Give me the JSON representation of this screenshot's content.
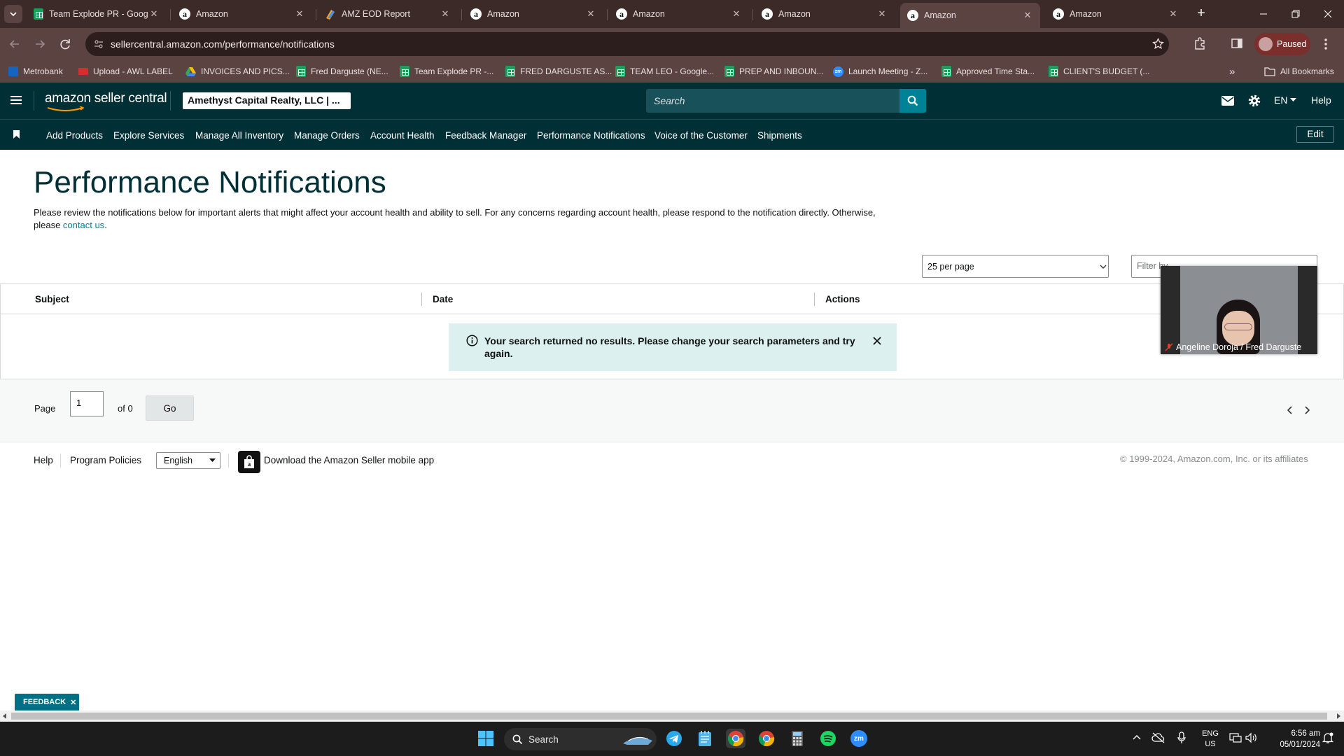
{
  "browser": {
    "tabs": [
      {
        "title": "Team Explode PR - Google Sheets",
        "icon": "sheets-icon",
        "active": false
      },
      {
        "title": "Amazon",
        "icon": "amazon-icon",
        "active": false
      },
      {
        "title": "AMZ EOD Report",
        "icon": "report-icon",
        "active": false
      },
      {
        "title": "Amazon",
        "icon": "amazon-icon",
        "active": false
      },
      {
        "title": "Amazon",
        "icon": "amazon-icon",
        "active": false
      },
      {
        "title": "Amazon",
        "icon": "amazon-icon",
        "active": false
      },
      {
        "title": "Amazon",
        "icon": "amazon-icon",
        "active": true
      },
      {
        "title": "Amazon",
        "icon": "amazon-icon",
        "active": false
      }
    ],
    "url": "sellercentral.amazon.com/performance/notifications",
    "profile_label": "Paused",
    "bookmarks": [
      {
        "label": "Metrobank",
        "icon": "metrobank-icon"
      },
      {
        "label": "Upload - AWL LABEL",
        "icon": "awl-icon"
      },
      {
        "label": "INVOICES AND PICS...",
        "icon": "drive-icon"
      },
      {
        "label": "Fred Darguste (NE...",
        "icon": "sheets-icon"
      },
      {
        "label": "Team Explode PR -...",
        "icon": "sheets-icon"
      },
      {
        "label": "FRED DARGUSTE AS...",
        "icon": "sheets-icon"
      },
      {
        "label": "TEAM LEO - Google...",
        "icon": "sheets-icon"
      },
      {
        "label": "PREP AND INBOUN...",
        "icon": "sheets-icon"
      },
      {
        "label": "Launch Meeting - Z...",
        "icon": "zoom-icon"
      },
      {
        "label": "Approved Time Sta...",
        "icon": "sheets-icon"
      },
      {
        "label": "CLIENT'S BUDGET (...",
        "icon": "sheets-icon"
      }
    ],
    "all_bookmarks_label": "All Bookmarks"
  },
  "seller_central": {
    "logo_text": "amazon seller central",
    "account_selector": "Amethyst Capital Realty, LLC | ...",
    "search_placeholder": "Search",
    "language": "EN",
    "help_label": "Help",
    "nav_items": [
      "Add Products",
      "Explore Services",
      "Manage All Inventory",
      "Manage Orders",
      "Account Health",
      "Feedback Manager",
      "Performance Notifications",
      "Voice of the Customer",
      "Shipments"
    ],
    "edit_label": "Edit"
  },
  "page": {
    "title": "Performance Notifications",
    "description_main": "Please review the notifications below for important alerts that might affect your account health and ability to sell. For any concerns regarding account health, please respond to the notification directly. Otherwise, please ",
    "contact_link": "contact us",
    "description_end": ".",
    "per_page": "25 per page",
    "filter_placeholder": "Filter by",
    "columns": [
      "Subject",
      "Date",
      "Actions"
    ],
    "alert_message": "Your search returned no results. Please change your search parameters and try again.",
    "pager": {
      "page_label": "Page",
      "page_value": "1",
      "of_label": "of 0",
      "go_label": "Go"
    }
  },
  "footer": {
    "help": "Help",
    "program_policies": "Program Policies",
    "language": "English",
    "download_app": "Download the Amazon Seller mobile app",
    "copyright": "© 1999-2024, Amazon.com, Inc. or its affiliates"
  },
  "video_overlay": {
    "name": "Angeline Doroja / Fred Darguste"
  },
  "feedback_label": "FEEDBACK",
  "taskbar": {
    "search_label": "Search",
    "lang_top": "ENG",
    "lang_bottom": "US",
    "time": "6:56 am",
    "date": "05/01/2024"
  },
  "colors": {
    "sc_header": "#002f36",
    "sc_teal": "#008296",
    "alert_bg": "#dcf0f0",
    "chrome_dark": "#3c2a29",
    "chrome_mid": "#5a4341"
  }
}
